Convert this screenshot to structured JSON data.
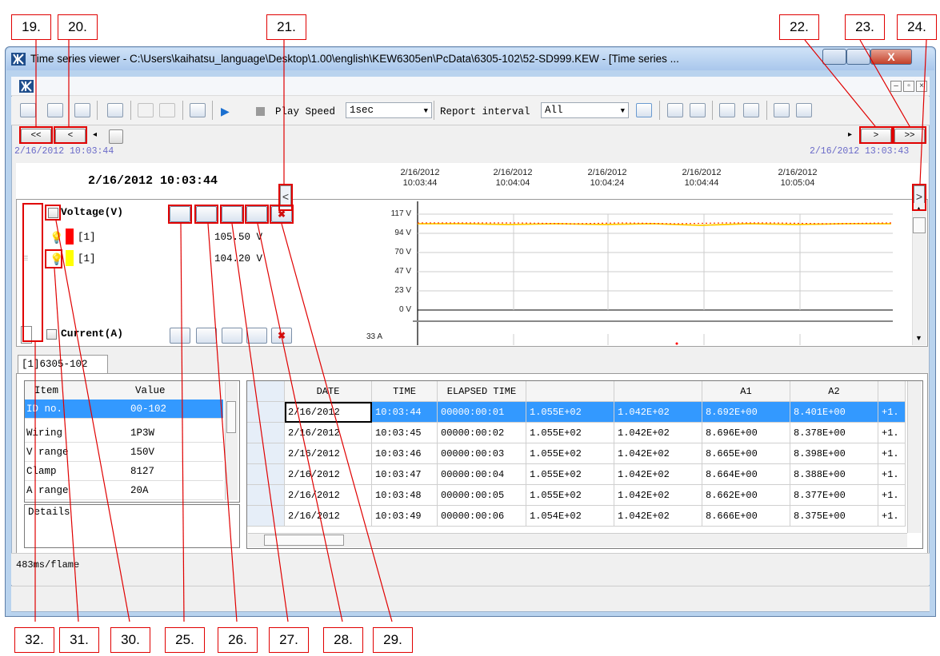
{
  "window": {
    "title": "Time series viewer - C:\\Users\\kaihatsu_language\\Desktop\\1.00\\english\\KEW6305en\\PcData\\6305-102\\52-SD999.KEW - [Time series ...",
    "close_glyph": "X"
  },
  "toolbar": {
    "play_speed_label": "Play Speed",
    "play_speed_value": "1sec",
    "report_interval_label": "Report interval",
    "report_interval_value": "All"
  },
  "nav": {
    "first": "<<",
    "prev": "<",
    "next": ">",
    "last": ">>",
    "start_time": "2/16/2012  10:03:44",
    "end_time": "2/16/2012  13:03:43"
  },
  "graph": {
    "current_time": "2/16/2012  10:03:44",
    "left_arrow": "<",
    "right_arrow": ">",
    "time_ticks": [
      {
        "date": "2/16/2012",
        "time": "10:03:44"
      },
      {
        "date": "2/16/2012",
        "time": "10:04:04"
      },
      {
        "date": "2/16/2012",
        "time": "10:04:24"
      },
      {
        "date": "2/16/2012",
        "time": "10:04:44"
      },
      {
        "date": "2/16/2012",
        "time": "10:05:04"
      }
    ],
    "voltage": {
      "title": "Voltage(V)",
      "rows": [
        {
          "label": "[1]",
          "value": "105.50  V",
          "color": "#ff0000"
        },
        {
          "label": "[1]",
          "value": "104.20  V",
          "color": "#ffff00"
        }
      ],
      "y_ticks": [
        "117 V",
        "94 V",
        "70 V",
        "47 V",
        "23 V",
        "0 V"
      ]
    },
    "current": {
      "title": "Current(A)",
      "y_top": "33 A"
    }
  },
  "tab": {
    "label": "[1]6305-102"
  },
  "properties": {
    "headers": [
      "Item",
      "Value"
    ],
    "rows": [
      {
        "item": "ID no.",
        "value": "00-102"
      },
      {
        "item": "Wiring",
        "value": "1P3W"
      },
      {
        "item": "V range",
        "value": "150V"
      },
      {
        "item": "Clamp",
        "value": "8127"
      },
      {
        "item": "A range",
        "value": "20A"
      }
    ],
    "details_label": "Details"
  },
  "table": {
    "headers": [
      "DATE",
      "TIME",
      "ELAPSED TIME",
      "",
      "",
      "A1",
      "A2"
    ],
    "rows": [
      [
        "2/16/2012",
        "10:03:44",
        "00000:00:01",
        "1.055E+02",
        "1.042E+02",
        "8.692E+00",
        "8.401E+00",
        "+1."
      ],
      [
        "2/16/2012",
        "10:03:45",
        "00000:00:02",
        "1.055E+02",
        "1.042E+02",
        "8.696E+00",
        "8.378E+00",
        "+1."
      ],
      [
        "2/16/2012",
        "10:03:46",
        "00000:00:03",
        "1.055E+02",
        "1.042E+02",
        "8.665E+00",
        "8.398E+00",
        "+1."
      ],
      [
        "2/16/2012",
        "10:03:47",
        "00000:00:04",
        "1.055E+02",
        "1.042E+02",
        "8.664E+00",
        "8.388E+00",
        "+1."
      ],
      [
        "2/16/2012",
        "10:03:48",
        "00000:00:05",
        "1.055E+02",
        "1.042E+02",
        "8.662E+00",
        "8.377E+00",
        "+1."
      ],
      [
        "2/16/2012",
        "10:03:49",
        "00000:00:06",
        "1.054E+02",
        "1.042E+02",
        "8.666E+00",
        "8.375E+00",
        "+1."
      ]
    ]
  },
  "status": {
    "frame_time": "483ms/flame"
  },
  "callouts": {
    "c19": "19.",
    "c20": "20.",
    "c21": "21.",
    "c22": "22.",
    "c23": "23.",
    "c24": "24.",
    "c25": "25.",
    "c26": "26.",
    "c27": "27.",
    "c28": "28.",
    "c29": "29.",
    "c30": "30.",
    "c31": "31.",
    "c32": "32."
  },
  "colors": {
    "highlight": "#3399ff",
    "callout": "#e00000",
    "voltage_line_red": "#ff0000",
    "voltage_line_yellow": "#ffcc00"
  }
}
